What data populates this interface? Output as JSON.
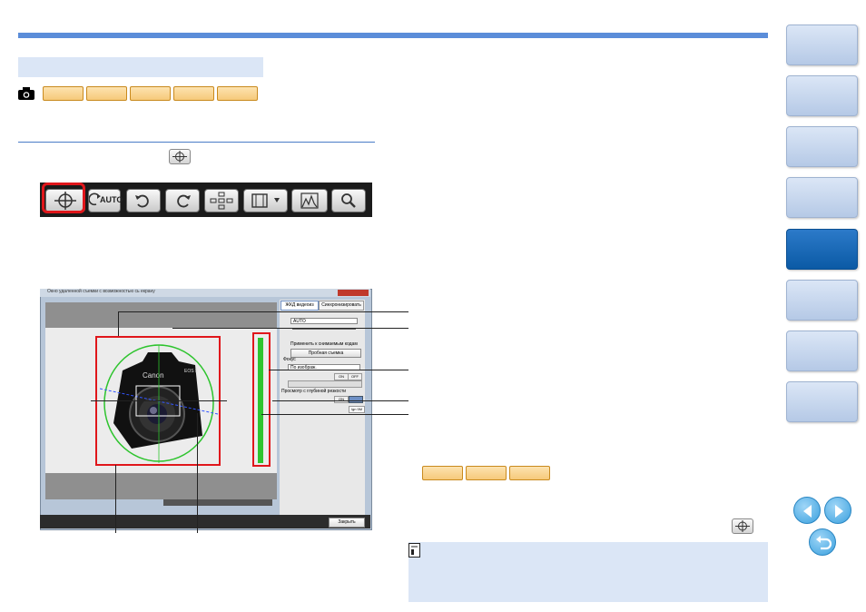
{
  "page": {
    "accent_color": "#5b8dd9",
    "section_band_color": "#dbe6f6",
    "active_tab_color": "#0b5aa5"
  },
  "header_band": {
    "text": ""
  },
  "model_tags_top": [
    "",
    "",
    "",
    "",
    ""
  ],
  "model_tags_right": [
    "",
    "",
    ""
  ],
  "toolbar": {
    "buttons": [
      {
        "name": "grid-overlay-button",
        "icon": "crosshair-icon",
        "label": ""
      },
      {
        "name": "auto-rotate-button",
        "icon": "auto-rotate-icon",
        "label": "AUTO"
      },
      {
        "name": "rotate-left-button",
        "icon": "rotate-left-icon",
        "label": ""
      },
      {
        "name": "rotate-right-button",
        "icon": "rotate-right-icon",
        "label": ""
      },
      {
        "name": "af-points-button",
        "icon": "af-points-icon",
        "label": ""
      },
      {
        "name": "aspect-ratio-button",
        "icon": "aspect-ratio-icon",
        "label": ""
      },
      {
        "name": "histogram-button",
        "icon": "histogram-icon",
        "label": ""
      },
      {
        "name": "zoom-button",
        "icon": "magnify-icon",
        "label": ""
      }
    ]
  },
  "screenshot": {
    "window_title": "Окно удаленной съемки с возможностью сь екрану",
    "tab_live": "ЖКД видеоиз",
    "tab_sync": "Синхронизировать",
    "wb_value": "AUTO",
    "apply_label": "Применить к снимаемым кодам",
    "test_shot_button": "Пробная съемка",
    "focus_label": "Фокус",
    "focus_mode": "По изображ.",
    "on_label": "ON",
    "off_label": "OFF",
    "dof_label": "Просмотр с глубиной резкости",
    "ok_label": "ON",
    "zoom_label": "Ign 5M",
    "close_button": "Закрыть",
    "camera_brand": "Canon",
    "camera_model": "EOS 5"
  },
  "side_tabs": [
    {
      "name": "side-tab-1",
      "label": ""
    },
    {
      "name": "side-tab-2",
      "label": ""
    },
    {
      "name": "side-tab-3",
      "label": ""
    },
    {
      "name": "side-tab-4",
      "label": ""
    },
    {
      "name": "side-tab-5",
      "label": "",
      "active": true
    },
    {
      "name": "side-tab-6",
      "label": ""
    },
    {
      "name": "side-tab-7",
      "label": ""
    },
    {
      "name": "side-tab-8",
      "label": ""
    }
  ],
  "note": {
    "icon": "note-icon",
    "text": ""
  }
}
